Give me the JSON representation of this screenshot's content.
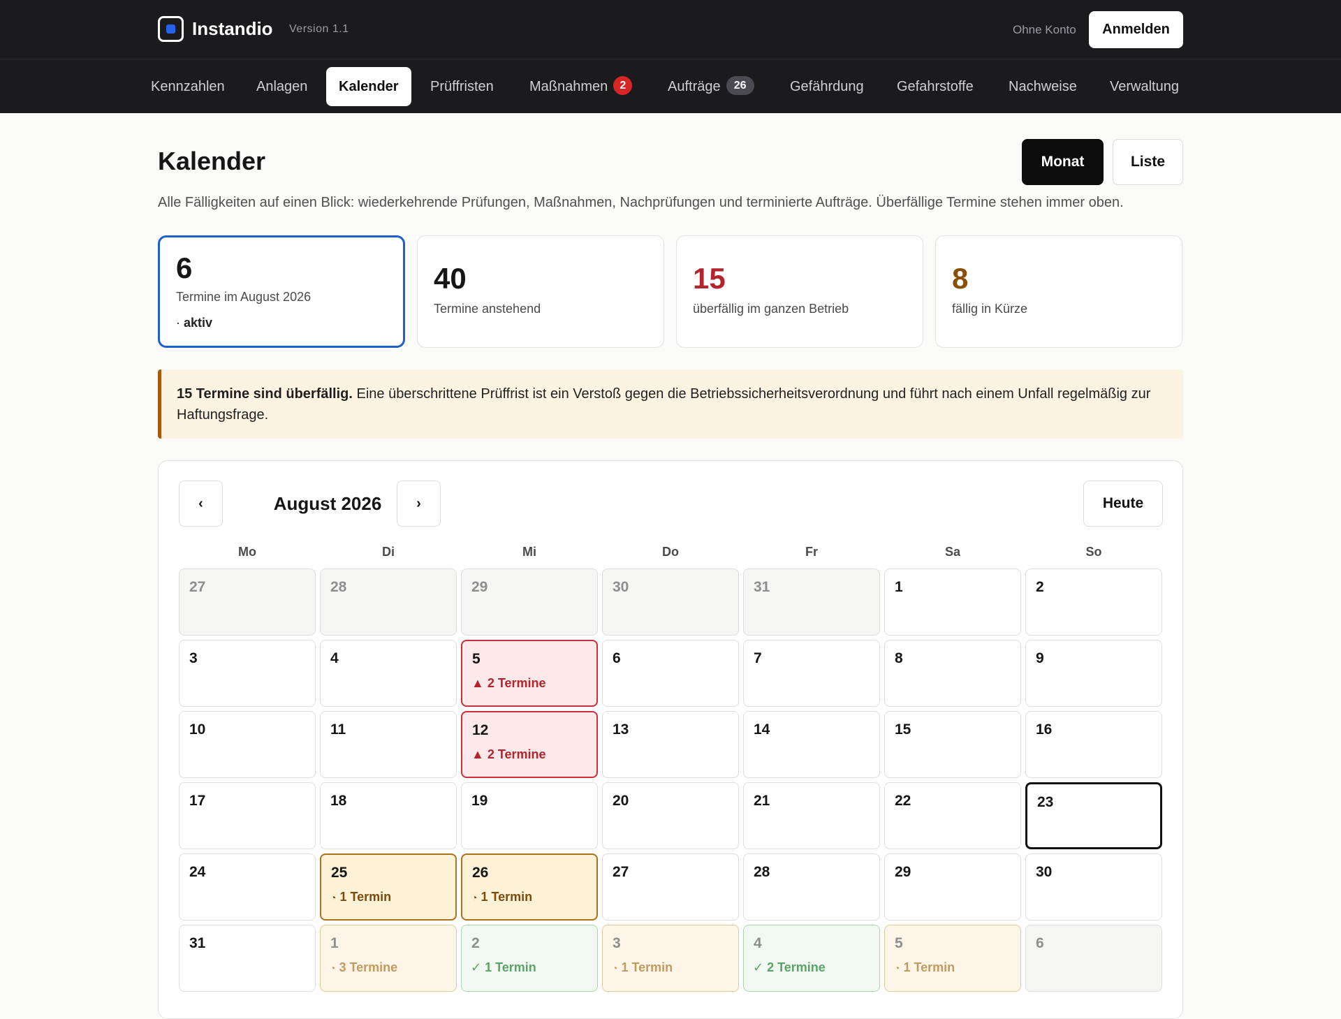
{
  "app": {
    "name": "Instandio",
    "version": "Version 1.1",
    "no_account": "Ohne Konto",
    "login_label": "Anmelden"
  },
  "nav": {
    "items": [
      {
        "label": "Kennzahlen"
      },
      {
        "label": "Anlagen"
      },
      {
        "label": "Kalender",
        "active": true
      },
      {
        "label": "Prüffristen"
      },
      {
        "label": "Maßnahmen",
        "badge": "2"
      },
      {
        "label": "Aufträge",
        "badge": "26"
      },
      {
        "label": "Gefährdung"
      },
      {
        "label": "Gefahrstoffe"
      },
      {
        "label": "Nachweise"
      },
      {
        "label": "Verwaltung"
      }
    ]
  },
  "page": {
    "title": "Kalender",
    "view_month": "Monat",
    "view_list": "Liste",
    "subtitle": "Alle Fälligkeiten auf einen Blick: wiederkehrende Prüfungen, Maßnahmen, Nachprüfungen und terminierte Aufträge. Überfällige Termine stehen immer oben."
  },
  "stats": [
    {
      "value": "6",
      "label": "Termine im August 2026",
      "extra_prefix": "· ",
      "extra": "aktiv",
      "color": "#161616"
    },
    {
      "value": "40",
      "label": "Termine anstehend",
      "color": "#161616"
    },
    {
      "value": "15",
      "label": "überfällig im ganzen Betrieb",
      "color": "#b3242c"
    },
    {
      "value": "8",
      "label": "fällig in Kürze",
      "color": "#8a4f06"
    }
  ],
  "alert": {
    "bold": "15 Termine sind überfällig.",
    "text": " Eine überschrittene Prüffrist ist ein Verstoß gegen die Betriebssicherheitsverordnung und führt nach einem Unfall regelmäßig zur Haftungsfrage."
  },
  "calendar": {
    "month_label": "August 2026",
    "prev_label": "‹",
    "next_label": "›",
    "today_label": "Heute",
    "weekdays": [
      "Mo",
      "Di",
      "Mi",
      "Do",
      "Fr",
      "Sa",
      "So"
    ],
    "weeks": [
      [
        {
          "day": "27",
          "state": "outside"
        },
        {
          "day": "28",
          "state": "outside"
        },
        {
          "day": "29",
          "state": "outside"
        },
        {
          "day": "30",
          "state": "outside"
        },
        {
          "day": "31",
          "state": "outside"
        },
        {
          "day": "1"
        },
        {
          "day": "2"
        }
      ],
      [
        {
          "day": "3"
        },
        {
          "day": "4"
        },
        {
          "day": "5",
          "state": "overdue",
          "icon": "▲",
          "events": "2 Termine"
        },
        {
          "day": "6"
        },
        {
          "day": "7"
        },
        {
          "day": "8"
        },
        {
          "day": "9"
        }
      ],
      [
        {
          "day": "10"
        },
        {
          "day": "11"
        },
        {
          "day": "12",
          "state": "overdue",
          "icon": "▲",
          "events": "2 Termine"
        },
        {
          "day": "13"
        },
        {
          "day": "14"
        },
        {
          "day": "15"
        },
        {
          "day": "16"
        }
      ],
      [
        {
          "day": "17"
        },
        {
          "day": "18"
        },
        {
          "day": "19"
        },
        {
          "day": "20"
        },
        {
          "day": "21"
        },
        {
          "day": "22"
        },
        {
          "day": "23",
          "state": "today"
        }
      ],
      [
        {
          "day": "24"
        },
        {
          "day": "25",
          "state": "soon",
          "icon": "◔",
          "events": "1 Termin"
        },
        {
          "day": "26",
          "state": "soon",
          "icon": "◔",
          "events": "1 Termin"
        },
        {
          "day": "27"
        },
        {
          "day": "28"
        },
        {
          "day": "29"
        },
        {
          "day": "30"
        }
      ],
      [
        {
          "day": "31"
        },
        {
          "day": "1",
          "state": "soon-out",
          "icon": "◔",
          "events": "3 Termine"
        },
        {
          "day": "2",
          "state": "done-out",
          "icon": "✓",
          "events": "1 Termin"
        },
        {
          "day": "3",
          "state": "soon-out",
          "icon": "◔",
          "events": "1 Termin"
        },
        {
          "day": "4",
          "state": "done-out",
          "icon": "✓",
          "events": "2 Termine"
        },
        {
          "day": "5",
          "state": "soon-out",
          "icon": "◔",
          "events": "1 Termin"
        },
        {
          "day": "6",
          "state": "outside"
        }
      ]
    ]
  }
}
